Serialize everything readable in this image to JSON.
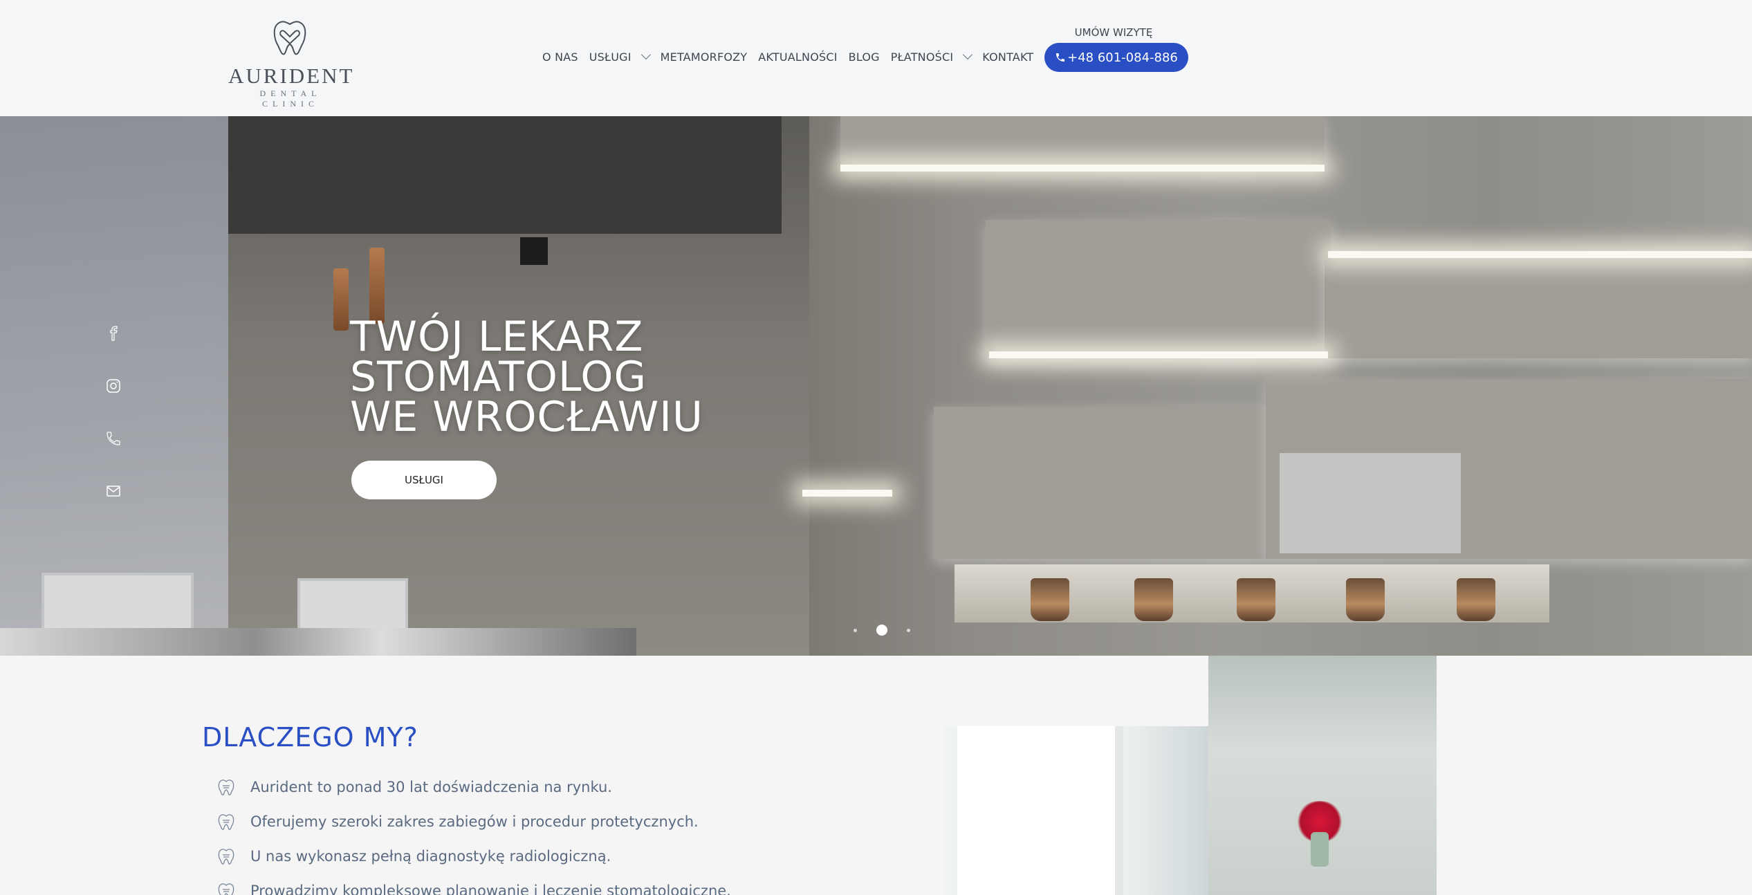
{
  "logo": {
    "name": "AURIDENT",
    "subtitle": "DENTAL CLINIC"
  },
  "nav": {
    "items": [
      {
        "label": "O NAS",
        "dropdown": false
      },
      {
        "label": "USŁUGI",
        "dropdown": true
      },
      {
        "label": "METAMORFOZY",
        "dropdown": false
      },
      {
        "label": "AKTUALNOŚCI",
        "dropdown": false
      },
      {
        "label": "BLOG",
        "dropdown": false
      },
      {
        "label": "PŁATNOŚCI",
        "dropdown": true
      },
      {
        "label": "KONTAKT",
        "dropdown": false
      }
    ]
  },
  "cta": {
    "label": "UMÓW WIZYTĘ",
    "phone": "+48 601-084-886"
  },
  "hero": {
    "title_lines": [
      "TWÓJ LEKARZ",
      "STOMATOLOG",
      "WE WROCŁAWIU"
    ],
    "button": "USŁUGI",
    "slides": 3,
    "active_slide": 2
  },
  "social": [
    "facebook-icon",
    "instagram-icon",
    "phone-icon",
    "mail-icon"
  ],
  "why": {
    "title": "DLACZEGO MY?",
    "items": [
      "Aurident to ponad 30 lat doświadczenia na rynku.",
      "Oferujemy szeroki zakres zabiegów i procedur protetycznych.",
      "U nas wykonasz pełną diagnostykę radiologiczną.",
      "Prowadzimy kompleksowe planowanie i leczenie stomatologiczne."
    ]
  },
  "colors": {
    "brand": "#2a4fc4",
    "text": "#5a6a80",
    "header_bg": "#f5f6f8"
  }
}
